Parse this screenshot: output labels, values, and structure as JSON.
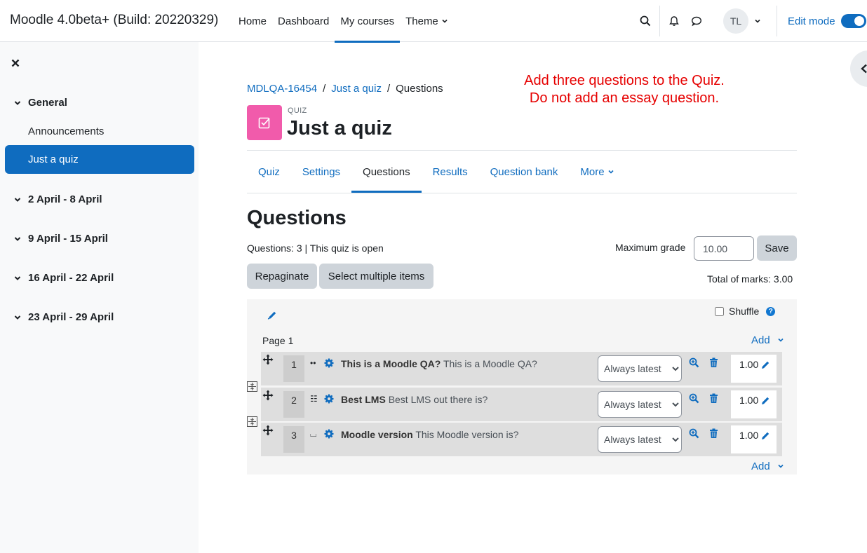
{
  "navbar": {
    "site_name": "Moodle 4.0beta+ (Build: 20220329)",
    "items": [
      {
        "label": "Home"
      },
      {
        "label": "Dashboard"
      },
      {
        "label": "My courses"
      },
      {
        "label": "Theme"
      }
    ],
    "user_initials": "TL",
    "edit_mode_label": "Edit mode",
    "edit_mode_on": true
  },
  "drawer": {
    "sections": [
      {
        "label": "General"
      },
      {
        "label": "2 April - 8 April"
      },
      {
        "label": "9 April - 15 April"
      },
      {
        "label": "16 April - 22 April"
      },
      {
        "label": "23 April - 29 April"
      }
    ],
    "links": [
      {
        "label": "Announcements"
      }
    ],
    "active_item": "Just a quiz"
  },
  "breadcrumb": [
    "MDLQA-16454",
    "Just a quiz",
    "Questions"
  ],
  "note": {
    "line1": "Add three questions to the Quiz.",
    "line2": "Do not add an essay question."
  },
  "header": {
    "kicker": "QUIZ",
    "title": "Just a quiz"
  },
  "tabs": [
    {
      "label": "Quiz"
    },
    {
      "label": "Settings"
    },
    {
      "label": "Questions"
    },
    {
      "label": "Results"
    },
    {
      "label": "Question bank"
    },
    {
      "label": "More"
    }
  ],
  "main": {
    "heading": "Questions",
    "status": "Questions: 3 | This quiz is open",
    "max_grade_label": "Maximum grade",
    "max_grade_value": "10.00",
    "save_label": "Save",
    "repaginate_label": "Repaginate",
    "select_multiple_label": "Select multiple items",
    "total_marks": "Total of marks: 3.00",
    "shuffle_label": "Shuffle",
    "page_label": "Page 1",
    "add_label": "Add"
  },
  "questions": [
    {
      "number": "1",
      "type_icon": "••",
      "name": "This is a Moodle QA?",
      "text": "This is a Moodle QA?",
      "version": "Always latest",
      "mark": "1.00"
    },
    {
      "number": "2",
      "type_icon": "☷",
      "name": "Best LMS",
      "text": "Best LMS out there is?",
      "version": "Always latest",
      "mark": "1.00"
    },
    {
      "number": "3",
      "type_icon": "⌴",
      "name": "Moodle version",
      "text": "This Moodle version is?",
      "version": "Always latest",
      "mark": "1.00"
    }
  ],
  "colors": {
    "primary": "#0f6cbf",
    "quiz_icon": "#f15bab",
    "note": "#e60000"
  }
}
